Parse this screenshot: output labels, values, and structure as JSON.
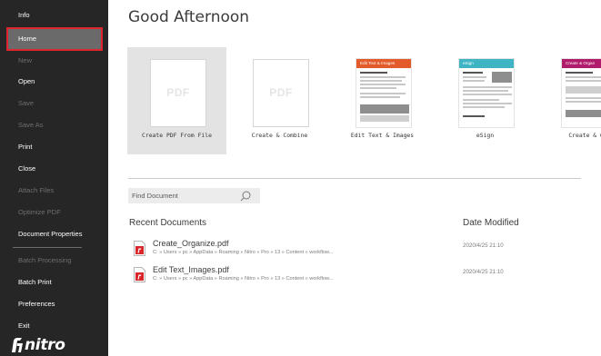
{
  "sidebar": {
    "items": [
      {
        "label": "Info",
        "state": "normal"
      },
      {
        "label": "Home",
        "state": "selected"
      },
      {
        "label": "New",
        "state": "disabled"
      },
      {
        "label": "Open",
        "state": "normal"
      },
      {
        "label": "Save",
        "state": "disabled"
      },
      {
        "label": "Save As",
        "state": "disabled"
      },
      {
        "label": "Print",
        "state": "normal"
      },
      {
        "label": "Close",
        "state": "normal"
      },
      {
        "label": "Attach Files",
        "state": "disabled"
      },
      {
        "label": "Optimize PDF",
        "state": "disabled"
      },
      {
        "label": "Document Properties",
        "state": "normal"
      },
      {
        "label": "Batch Processing",
        "state": "disabled"
      },
      {
        "label": "Batch Print",
        "state": "normal"
      },
      {
        "label": "Preferences",
        "state": "normal"
      },
      {
        "label": "Exit",
        "state": "normal"
      }
    ],
    "logo_text": "nitro"
  },
  "main": {
    "greeting": "Good Afternoon",
    "tiles": [
      {
        "label": "Create PDF From File",
        "thumb_text": "PDF"
      },
      {
        "label": "Create & Combine",
        "thumb_text": "PDF"
      },
      {
        "label": "Edit Text & Images",
        "thumb_header": "Edit Text & Images",
        "accent": "#e35b2a"
      },
      {
        "label": "eSign",
        "thumb_header": "eSign",
        "accent": "#3fb5c4"
      },
      {
        "label": "Create & Or",
        "thumb_header": "Create & Organ",
        "accent": "#b01c6b"
      }
    ],
    "search": {
      "placeholder": "Find Document",
      "icon": "search-icon"
    },
    "recent_header": "Recent Documents",
    "date_header": "Date Modified",
    "recent": [
      {
        "name": "Create_Organize.pdf",
        "path": "C: » Users » pc » AppData » Roaming » Nitro » Pro » 13 » Content » workflow...",
        "date": "2020/4/25 21:10"
      },
      {
        "name": "Edit Text_Images.pdf",
        "path": "C: » Users » pc » AppData » Roaming » Nitro » Pro » 13 » Content » workflow...",
        "date": "2020/4/25 21:10"
      }
    ]
  },
  "colors": {
    "sidebar_bg": "#262626",
    "selection_outline": "#e0242d",
    "pdf_icon_red": "#d9262b"
  }
}
